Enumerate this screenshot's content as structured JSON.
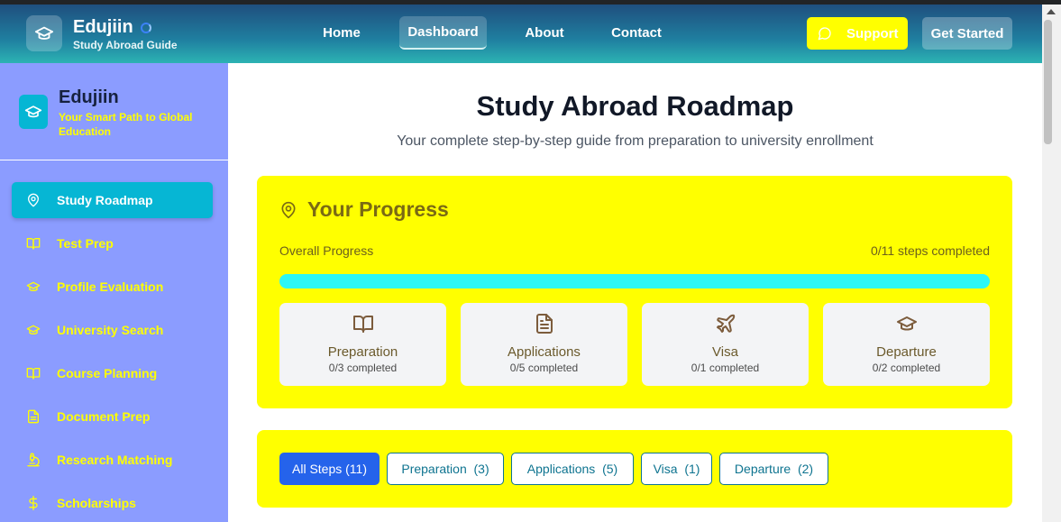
{
  "header": {
    "brand_title": "Edujiin",
    "brand_subtitle": "Study Abroad Guide",
    "nav": [
      "Home",
      "Dashboard",
      "About",
      "Contact"
    ],
    "active_nav": "Dashboard",
    "support_label": "Support",
    "get_started_label": "Get Started"
  },
  "sidebar": {
    "title": "Edujiin",
    "tagline": "Your Smart Path to Global Education",
    "items": [
      {
        "label": "Study Roadmap",
        "icon": "map-pin-icon",
        "active": true
      },
      {
        "label": "Test Prep",
        "icon": "book-open-icon"
      },
      {
        "label": "Profile Evaluation",
        "icon": "graduation-cap-icon"
      },
      {
        "label": "University Search",
        "icon": "graduation-cap-icon"
      },
      {
        "label": "Course Planning",
        "icon": "book-open-icon"
      },
      {
        "label": "Document Prep",
        "icon": "file-text-icon"
      },
      {
        "label": "Research Matching",
        "icon": "microscope-icon"
      },
      {
        "label": "Scholarships",
        "icon": "dollar-sign-icon"
      }
    ]
  },
  "main": {
    "title": "Study Abroad Roadmap",
    "subtitle": "Your complete step-by-step guide from preparation to university enrollment",
    "progress": {
      "heading": "Your Progress",
      "label": "Overall Progress",
      "summary": "0/11 steps completed",
      "fraction": 0,
      "stats": [
        {
          "name": "Preparation",
          "count": "0/3 completed",
          "icon": "book-open-icon"
        },
        {
          "name": "Applications",
          "count": "0/5 completed",
          "icon": "file-text-icon"
        },
        {
          "name": "Visa",
          "count": "0/1 completed",
          "icon": "plane-icon"
        },
        {
          "name": "Departure",
          "count": "0/2 completed",
          "icon": "graduation-cap-icon"
        }
      ]
    },
    "filters": [
      {
        "label": "All Steps (11)",
        "active": true
      },
      {
        "label": "Preparation  (3)"
      },
      {
        "label": "Applications  (5)"
      },
      {
        "label": "Visa  (1)"
      },
      {
        "label": "Departure  (2)"
      }
    ]
  },
  "colors": {
    "navbar_start": "#1f4f7e",
    "navbar_end": "#2cb3b3",
    "sidebar_bg": "#8b9cff",
    "sidebar_text": "#ffff00",
    "active_item": "#06b6d4",
    "card_bg": "#ffff00",
    "progress_track": "#2cf7f5",
    "filter_active": "#2563eb"
  }
}
